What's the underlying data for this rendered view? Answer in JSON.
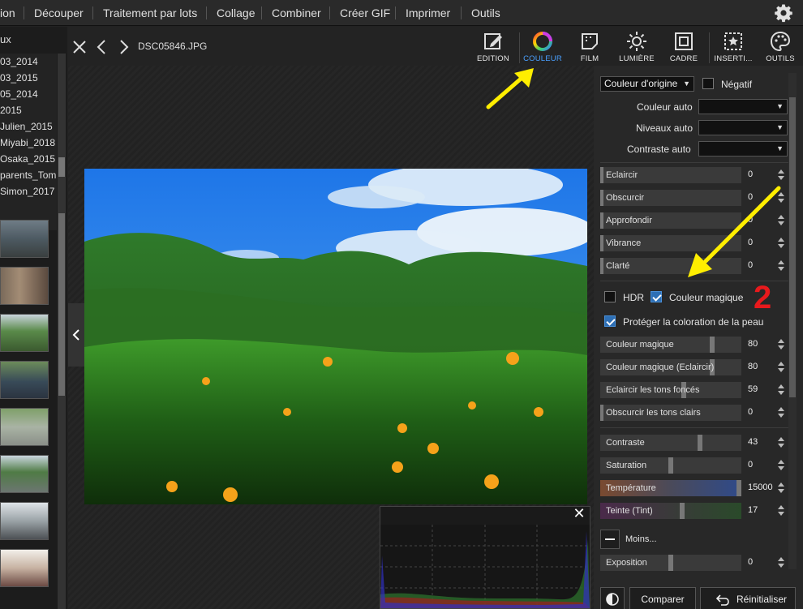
{
  "menu": {
    "items": [
      "ion",
      "Découper",
      "Traitement par lots",
      "Collage",
      "Combiner",
      "Créer GIF",
      "Imprimer",
      "Outils"
    ]
  },
  "left": {
    "title": "ux",
    "folders": [
      "03_2014",
      "03_2015",
      "05_2014",
      "2015",
      "Julien_2015",
      "Miyabi_2018",
      "Osaka_2015",
      "parents_Tom",
      "Simon_2017"
    ]
  },
  "viewer": {
    "filename": "DSC05846.JPG",
    "tools": [
      "EDITION",
      "COULEUR",
      "FILM",
      "LUMIÈRE",
      "CADRE",
      "INSERTI...",
      "OUTILS"
    ],
    "active_tool": "COULEUR"
  },
  "panel": {
    "origin_select": "Couleur d'origine",
    "negatif_label": "Négatif",
    "auto_rows": [
      {
        "label": "Couleur auto",
        "value": ""
      },
      {
        "label": "Niveaux auto",
        "value": ""
      },
      {
        "label": "Contraste auto",
        "value": ""
      }
    ],
    "sliders_a": [
      {
        "label": "Eclaircir",
        "value": "0"
      },
      {
        "label": "Obscurcir",
        "value": "0"
      },
      {
        "label": "Approfondir",
        "value": "0"
      },
      {
        "label": "Vibrance",
        "value": "0"
      },
      {
        "label": "Clarté",
        "value": "0"
      }
    ],
    "hdr_label": "HDR",
    "magic_label": "Couleur magique",
    "protect_label": "Protéger la coloration de la peau",
    "sliders_b": [
      {
        "label": "Couleur magique",
        "value": "80"
      },
      {
        "label": "Couleur magique (Eclaircir)",
        "value": "80"
      },
      {
        "label": "Eclaircir les tons foncés",
        "value": "59"
      },
      {
        "label": "Obscurcir les tons clairs",
        "value": "0"
      }
    ],
    "sliders_c": [
      {
        "label": "Contraste",
        "value": "43"
      },
      {
        "label": "Saturation",
        "value": "0"
      },
      {
        "label": "Température",
        "value": "15000"
      },
      {
        "label": "Teinte (Tint)",
        "value": "17"
      }
    ],
    "less_label": "Moins...",
    "exposure": {
      "label": "Exposition",
      "value": "0"
    },
    "compare_label": "Comparer",
    "reset_label": "Réinitialiser",
    "annotation_number": "2"
  },
  "colors": {
    "accent": "#4aa0ff",
    "annotation_arrow": "#ffee00",
    "annotation_number": "#e8191c"
  }
}
